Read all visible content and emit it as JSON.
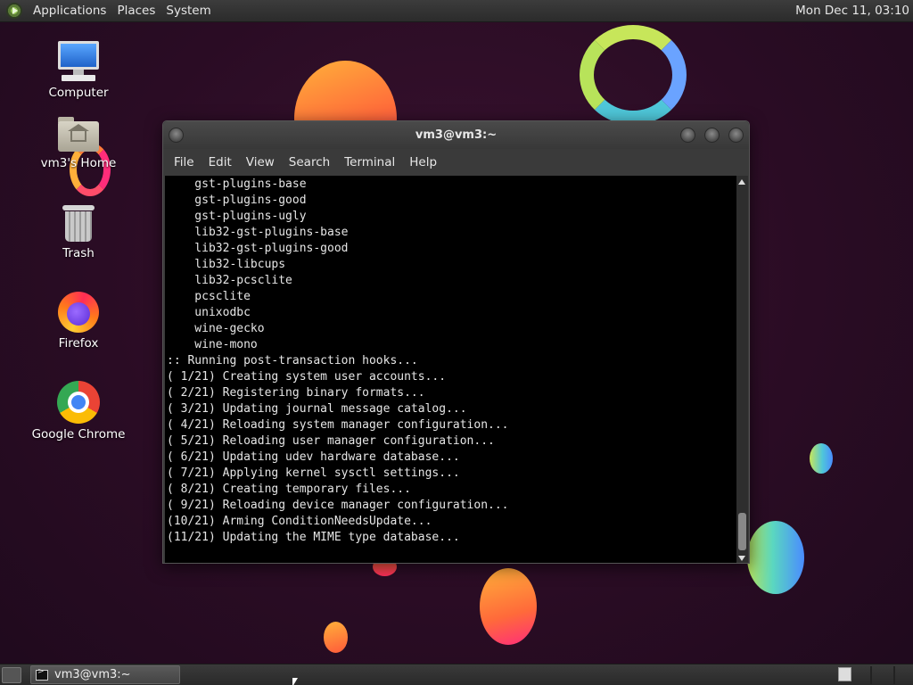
{
  "top_panel": {
    "menus": [
      "Applications",
      "Places",
      "System"
    ],
    "clock": "Mon Dec 11, 03:10"
  },
  "desktop_icons": [
    {
      "label": "Computer",
      "icon": "computer-icon"
    },
    {
      "label": "vm3's Home",
      "icon": "home-folder-icon"
    },
    {
      "label": "Trash",
      "icon": "trash-icon"
    },
    {
      "label": "Firefox",
      "icon": "firefox-icon"
    },
    {
      "label": "Google Chrome",
      "icon": "chrome-icon"
    }
  ],
  "terminal": {
    "title": "vm3@vm3:~",
    "menu": [
      "File",
      "Edit",
      "View",
      "Search",
      "Terminal",
      "Help"
    ],
    "lines": [
      "    gst-plugins-base",
      "    gst-plugins-good",
      "    gst-plugins-ugly",
      "    lib32-gst-plugins-base",
      "    lib32-gst-plugins-good",
      "    lib32-libcups",
      "    lib32-pcsclite",
      "    pcsclite",
      "    unixodbc",
      "    wine-gecko",
      "    wine-mono",
      ":: Running post-transaction hooks...",
      "( 1/21) Creating system user accounts...",
      "( 2/21) Registering binary formats...",
      "( 3/21) Updating journal message catalog...",
      "( 4/21) Reloading system manager configuration...",
      "( 5/21) Reloading user manager configuration...",
      "( 6/21) Updating udev hardware database...",
      "( 7/21) Applying kernel sysctl settings...",
      "( 8/21) Creating temporary files...",
      "( 9/21) Reloading device manager configuration...",
      "(10/21) Arming ConditionNeedsUpdate...",
      "(11/21) Updating the MIME type database..."
    ]
  },
  "taskbar": {
    "tasks": [
      {
        "label": "vm3@vm3:~",
        "icon": "terminal-icon"
      }
    ]
  }
}
